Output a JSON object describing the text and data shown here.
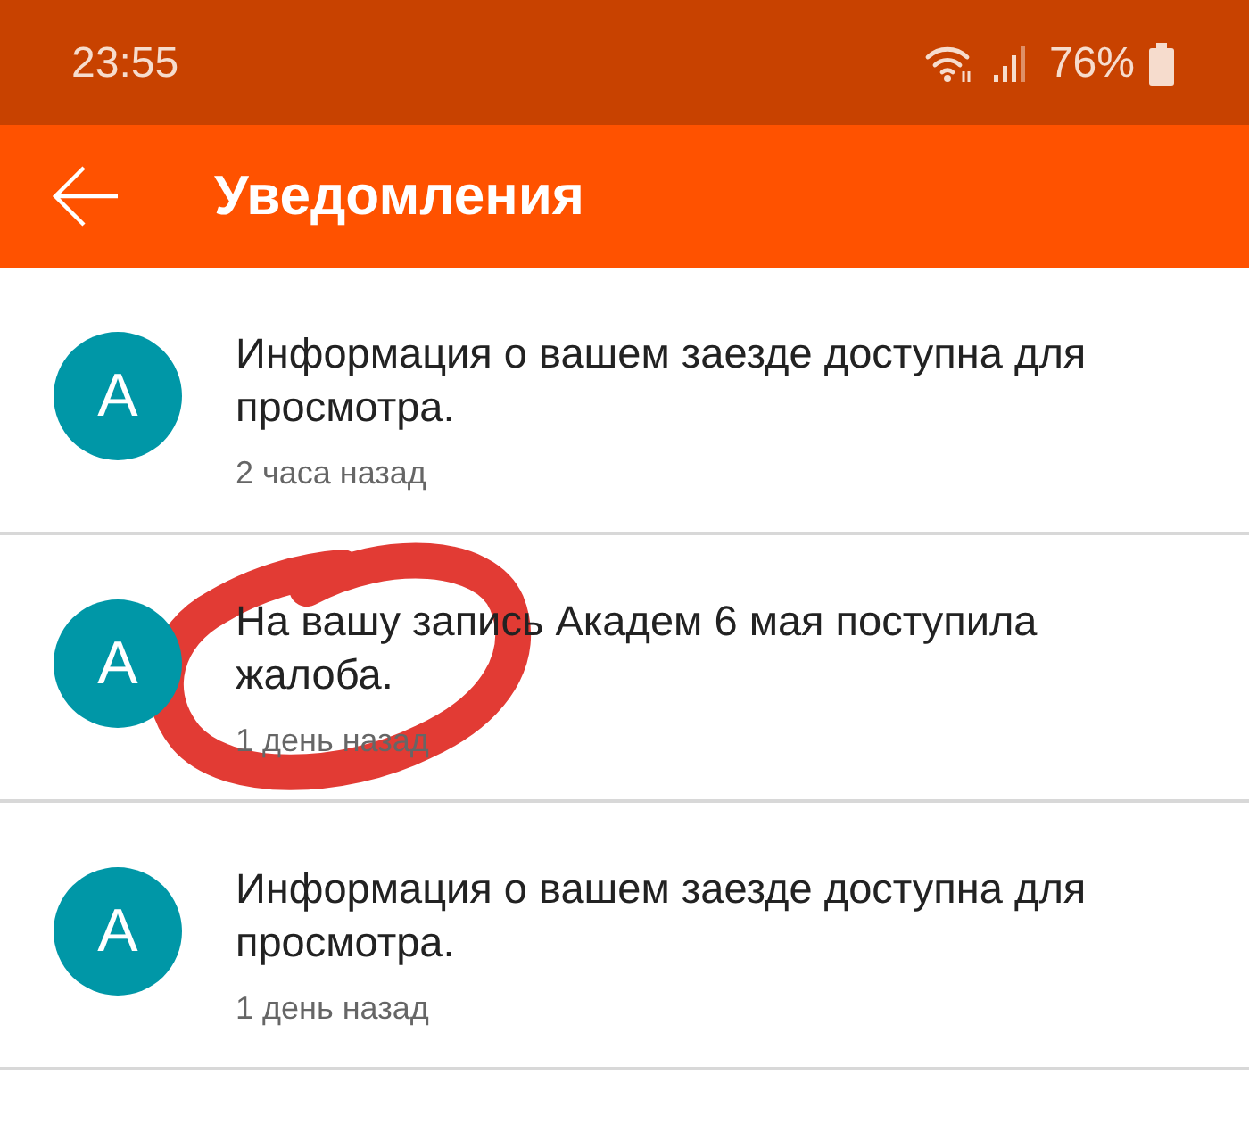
{
  "status_bar": {
    "time": "23:55",
    "battery": "76%"
  },
  "header": {
    "title": "Уведомления"
  },
  "notifications": [
    {
      "avatar": "A",
      "text": "Информация о вашем заезде доступна для просмотра.",
      "time": "2 часа назад"
    },
    {
      "avatar": "A",
      "text": "На вашу запись Академ 6 мая поступила жалоба.",
      "time": "1 день назад"
    },
    {
      "avatar": "A",
      "text": "Информация о вашем заезде доступна для просмотра.",
      "time": "1 день назад"
    }
  ]
}
